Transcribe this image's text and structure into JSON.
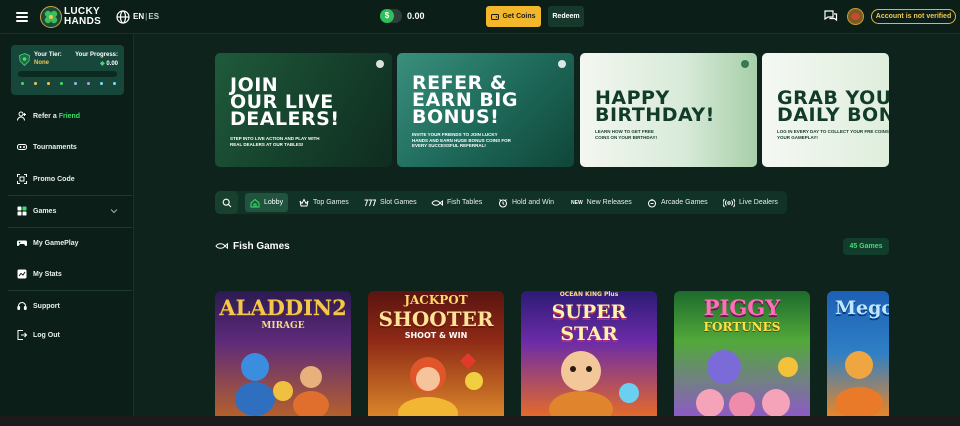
{
  "header": {
    "logo_line1": "LUCKY",
    "logo_line2": "HANDS",
    "lang_active": "EN",
    "lang_separator": "|",
    "lang_other": "ES",
    "coin_symbol": "$",
    "balance": "0.00",
    "get_coins_label": "Get Coins",
    "redeem_label": "Redeem",
    "verify_label": "Account is not verified"
  },
  "sidebar": {
    "tier_label": "Your Tier:",
    "tier_value": "None",
    "progress_label": "Your Progress:",
    "progress_value": "0.00",
    "progress_fraction": 0,
    "tier_dot_colors": [
      "#3ce06b",
      "#f2c653",
      "#f2c653",
      "#3ce06b",
      "#9ab3ff",
      "#cf8bff",
      "#6ae3ff",
      "#6ae3ff"
    ],
    "items": [
      {
        "label": "Refer a",
        "accent": "Friend",
        "icon": "refer-friend-icon"
      },
      {
        "label": "Tournaments",
        "icon": "gamepad-icon"
      },
      {
        "label": "Promo Code",
        "icon": "promo-code-icon"
      },
      {
        "label": "Games",
        "icon": "games-grid-icon"
      },
      {
        "label": "My GamePlay",
        "icon": "controller-icon"
      },
      {
        "label": "My Stats",
        "icon": "stats-icon"
      },
      {
        "label": "Support",
        "icon": "headset-icon"
      },
      {
        "label": "Log Out",
        "icon": "logout-icon"
      }
    ]
  },
  "banners": [
    {
      "title_lines": [
        "JOIN",
        "OUR LIVE",
        "DEALERS!"
      ],
      "sub": "STEP INTO LIVE ACTION AND PLAY WITH REAL DEALERS AT OUR TABLES!"
    },
    {
      "title_lines": [
        "REFER &",
        "EARN BIG",
        "BONUS!"
      ],
      "sub": "INVITE YOUR FRIENDS TO JOIN LUCKY HANDS AND EARN HUGE BONUS COINS FOR EVERY SUCCESSFUL REFERRAL!"
    },
    {
      "title_lines": [
        "HAPPY",
        "BIRTHDAY!"
      ],
      "sub": "LEARN HOW TO GET FREE COINS ON YOUR BIRTHDAY!"
    },
    {
      "title_lines": [
        "GRAB YOUR",
        "DAILY BONU"
      ],
      "sub": "LOG IN EVERY DAY TO COLLECT YOUR FRE COINS AND BOOST YOUR GAMEPLAY!"
    }
  ],
  "tabs": [
    {
      "label": "Lobby",
      "icon": "home-icon",
      "active": true
    },
    {
      "label": "Top Games",
      "icon": "crown-icon"
    },
    {
      "label": "Slot Games",
      "icon": "slot-777-icon"
    },
    {
      "label": "Fish Tables",
      "icon": "fish-icon"
    },
    {
      "label": "Hold and Win",
      "icon": "hold-win-icon"
    },
    {
      "label": "New Releases",
      "badge": "NEW",
      "icon": "new-badge-icon"
    },
    {
      "label": "Arcade Games",
      "icon": "arcade-icon"
    },
    {
      "label": "Live Dealers",
      "icon": "live-broadcast-icon"
    }
  ],
  "section": {
    "title": "Fish Games",
    "count": "45 Games"
  },
  "games": [
    {
      "title": "ALADDIN2",
      "subtitle": "MIRAGE"
    },
    {
      "title_top": "JACKPOT",
      "title": "SHOOTER",
      "subtitle": "SHOOT & WIN"
    },
    {
      "title_top": "OCEAN KING Plus",
      "title": "SUPER STAR"
    },
    {
      "title": "PIGGY",
      "subtitle": "FORTUNES"
    },
    {
      "title": "Mego"
    }
  ]
}
